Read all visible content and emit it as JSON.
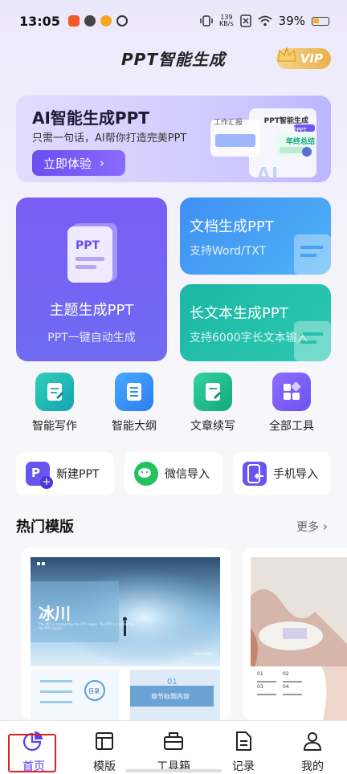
{
  "status": {
    "time": "13:05",
    "net_speed": "139",
    "net_unit": "KB/s",
    "battery": "39%"
  },
  "app": {
    "title": "PPT智能生成",
    "vip": "VIP"
  },
  "banner": {
    "title": "AI智能生成PPT",
    "subtitle": "只需一句话，AI帮你打造完美PPT",
    "button": "立即体验",
    "mock_title": "PPT智能生成",
    "mock_tag": "工作汇报",
    "mock_tag2": "生成PPT",
    "mock_tag3": "年终总结"
  },
  "cards": {
    "theme": {
      "title": "主题生成PPT",
      "subtitle": "PPT一键自动生成",
      "icon_text": "PPT"
    },
    "doc": {
      "title": "文档生成PPT",
      "subtitle": "支持Word/TXT"
    },
    "long": {
      "title": "长文本生成PPT",
      "subtitle": "支持6000字长文本输入"
    }
  },
  "tools": [
    {
      "label": "智能写作",
      "color": "#1fb6b3"
    },
    {
      "label": "智能大纲",
      "color": "#2f8ff0"
    },
    {
      "label": "文章续写",
      "color": "#1fb38e"
    },
    {
      "label": "全部工具",
      "color": "#7b5cf0"
    }
  ],
  "imports": [
    {
      "label": "新建PPT",
      "color": "#6a54f0"
    },
    {
      "label": "微信导入",
      "color": "#22c35e"
    },
    {
      "label": "手机导入",
      "color": "#6a54f0"
    }
  ],
  "section": {
    "title": "热门模版",
    "more": "更多"
  },
  "template1": {
    "title": "冰川",
    "desc": "The PPT is created by the PPT maker. The PPT is created by the PPT maker.",
    "logo": "YOUR LOGO",
    "num": "01",
    "chapter": "章节标题内容",
    "center_label": "目录"
  },
  "template2": {
    "n1": "01",
    "n2": "02",
    "n3": "03",
    "n4": "04"
  },
  "tabs": [
    {
      "label": "首页"
    },
    {
      "label": "模版"
    },
    {
      "label": "工具箱"
    },
    {
      "label": "记录"
    },
    {
      "label": "我的"
    }
  ]
}
